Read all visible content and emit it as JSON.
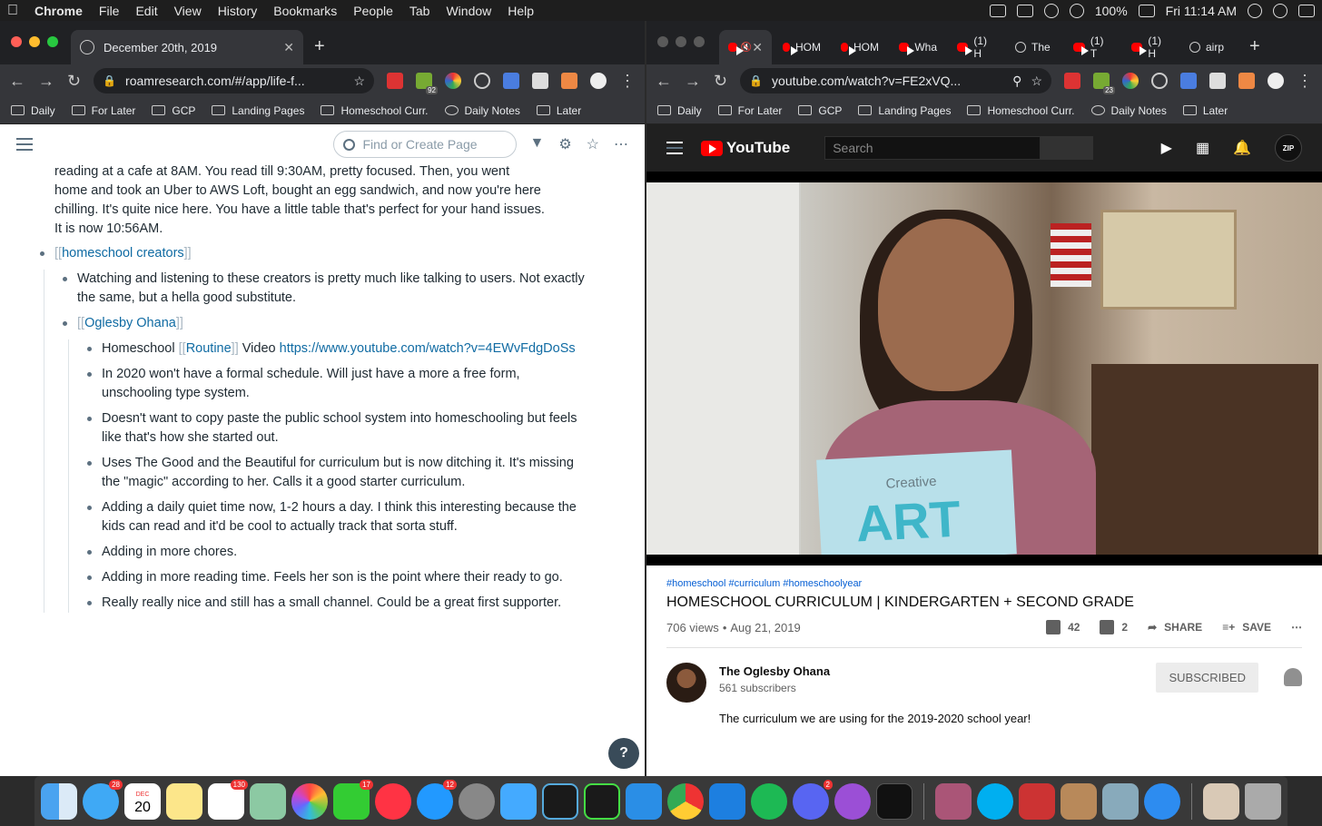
{
  "menubar": {
    "app": "Chrome",
    "items": [
      "File",
      "Edit",
      "View",
      "History",
      "Bookmarks",
      "People",
      "Tab",
      "Window",
      "Help"
    ],
    "battery": "100%",
    "clock": "Fri 11:14 AM"
  },
  "left_window": {
    "tab_title": "December 20th, 2019",
    "url": "roamresearch.com/#/app/life-f...",
    "bookmarks": [
      "Daily",
      "For Later",
      "GCP",
      "Landing Pages",
      "Homeschool Curr.",
      "Daily Notes",
      "Later"
    ],
    "search_placeholder": "Find or Create Page",
    "help_label": "?",
    "intro": "reading at a cafe at 8AM. You read till 9:30AM, pretty focused. Then, you went home and took an Uber to AWS Loft, bought an egg sandwich, and now you're here chilling. It's quite nice here. You have a little table that's perfect for your hand issues. It is now 10:56AM.",
    "creators_link": "homeschool creators",
    "creators_note": "Watching and listening to these creators is pretty much like talking to users. Not exactly the same, but a hella good substitute.",
    "ohana_link": "Oglesby Ohana",
    "video_prefix": "Homeschool ",
    "routine_link": "Routine",
    "video_word": " Video ",
    "video_url": "https://www.youtube.com/watch?v=4EWvFdgDoSs",
    "notes": [
      "In 2020 won't have a formal schedule. Will just have a more a free form, unschooling type system.",
      "Doesn't want to copy paste the public school system into homeschooling but feels like that's how she started out.",
      "Uses The Good and the Beautiful for curriculum but is now ditching it. It's missing the \"magic\" according to her. Calls it a good starter curriculum.",
      "Adding a daily quiet time now, 1-2 hours a day. I think this interesting because the kids can read and it'd be cool to actually track that sorta stuff.",
      "Adding in more chores.",
      "Adding in more reading time. Feels her son is the point where their ready to go.",
      "Really really nice and still has a small channel. Could be a great first supporter."
    ],
    "extension_badge": "92"
  },
  "right_window": {
    "tabs": [
      "HOM",
      "HOM",
      "Wha",
      "(1) H",
      "The",
      "(1) T",
      "(1) H",
      "airp"
    ],
    "url": "youtube.com/watch?v=FE2xVQ...",
    "extension_badge": "23",
    "bookmarks": [
      "Daily",
      "For Later",
      "GCP",
      "Landing Pages",
      "Homeschool Curr.",
      "Daily Notes",
      "Later"
    ],
    "yt_logo": "YouTube",
    "yt_search_placeholder": "Search",
    "avatar_text": "ZIP",
    "book_title": "Creative",
    "book_letters": "ART",
    "tags": "#homeschool #curriculum #homeschoolyear",
    "video_title": "HOMESCHOOL CURRICULUM | KINDERGARTEN + SECOND GRADE",
    "views": "706 views",
    "date": "Aug 21, 2019",
    "likes": "42",
    "dislikes": "2",
    "share": "SHARE",
    "save": "SAVE",
    "channel_name": "The Oglesby Ohana",
    "subscribers": "561 subscribers",
    "subscribed_label": "SUBSCRIBED",
    "description": "The curriculum we are using for the 2019-2020 school year!"
  },
  "dock": {
    "apps": [
      "finder",
      "messages",
      "calendar",
      "notes",
      "reminders",
      "maps",
      "photos",
      "facetime",
      "news",
      "app-store",
      "system-preferences",
      "bookmarks",
      "goland",
      "pycharm",
      "vscode",
      "chrome",
      "xcode",
      "spotify",
      "discord",
      "podcasts",
      "apple-tv",
      "calculator",
      "skype",
      "photo-booth",
      "contacts",
      "preview",
      "safari",
      "document",
      "trash"
    ],
    "badges": {
      "messages": "28",
      "calendar_month": "DEC",
      "calendar_day": "20",
      "reminders": "130",
      "facetime": "17",
      "app_store": "12",
      "discord": "2"
    }
  }
}
